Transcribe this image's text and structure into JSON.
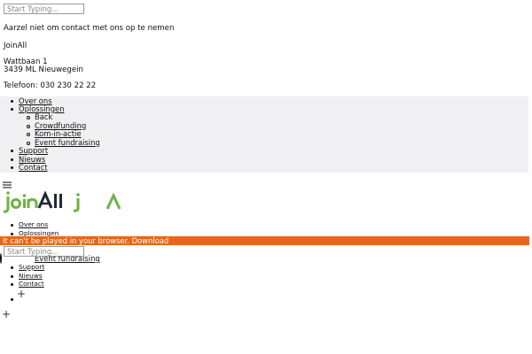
{
  "top_search": {
    "placeholder": "Start Typing..."
  },
  "contact": {
    "heading": "Aarzel niet om contact met ons op te nemen",
    "company": "JoinAll",
    "street": "Wattbaan 1",
    "postal_city": "3439 ML Nieuwegein",
    "phone": "Telefoon: 030 230 22 22"
  },
  "mobile_menu": {
    "items": [
      {
        "label": "Over ons"
      },
      {
        "label": "Oplossingen"
      },
      {
        "label": "Support"
      },
      {
        "label": "Nieuws"
      },
      {
        "label": "Contact"
      }
    ],
    "sub_items": [
      {
        "label": "Back"
      },
      {
        "label": "Crowdfunding"
      },
      {
        "label": "Kom-in-actie"
      },
      {
        "label": "Event fundraising"
      }
    ]
  },
  "header": {
    "hamburger_icon": "hamburger-icon",
    "logo_text": "joinAll",
    "logo_color": "#6db33f",
    "logo_dark": "#1f2a33"
  },
  "main_menu": {
    "items": [
      {
        "label": "Over ons"
      },
      {
        "label": "Oplossingen"
      },
      {
        "label": "Support"
      },
      {
        "label": "Nieuws"
      },
      {
        "label": "Contact"
      }
    ],
    "sub_visible": {
      "label": "Event fundraising"
    }
  },
  "video_banner": {
    "text": "It can't be played in your browser.",
    "link": "Download",
    "color": "#e8651a"
  },
  "overlay_search": {
    "placeholder": "Start Typing..."
  },
  "plus_icon": "plus-icon"
}
